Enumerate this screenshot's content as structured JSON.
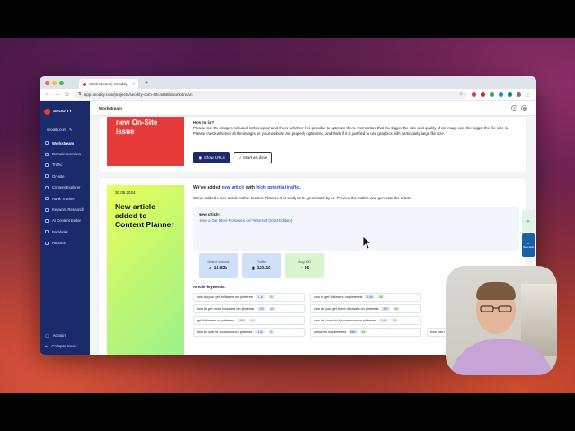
{
  "browser": {
    "tab_title": "Workstream | Seodity",
    "tab_close": "×",
    "new_tab": "+",
    "url": "app.seodity.com/projects/seodity-com-40c4a58b/workstream"
  },
  "sidebar": {
    "brand": "SEODITY",
    "domain": "seodity.com",
    "items": [
      {
        "label": "Workstream"
      },
      {
        "label": "Domain overview"
      },
      {
        "label": "Traffic"
      },
      {
        "label": "On-site"
      },
      {
        "label": "Content Explorer"
      },
      {
        "label": "Rank Tracker"
      },
      {
        "label": "Keyword Research"
      },
      {
        "label": "AI Content Editor"
      },
      {
        "label": "Backlinks"
      },
      {
        "label": "Reports"
      }
    ],
    "account": "Account",
    "collapse": "Collapse menu"
  },
  "topbar": {
    "title": "Workstream",
    "help": "?",
    "settings": "⚙"
  },
  "card1": {
    "hero_title": "new On-Site issue",
    "heading": "How to fix?",
    "text": "Please see the images included in this report and check whether it is possible to optimize them. Remember that the bigger the size and quality of an image are, the bigger the file size is. Please check whether all the images on your website are properly optimized, and think if it is justified to use graphics with particularly large file size.",
    "primary_btn": "Show URLs",
    "secondary_btn": "Mark as done"
  },
  "card2": {
    "date": "30.05.2024",
    "hero_title": "New article added to Content Planner",
    "headline_pre": "We've added ",
    "headline_link1": "new article",
    "headline_mid": " with ",
    "headline_link2": "high potential traffic",
    "headline_end": ".",
    "description": "We've added a new article to the Content Planner. It is ready to be generated by AI. Preview the outline and generate the article.",
    "new_article_label": "New article:",
    "new_article_link": "How to Get More Followers on Pinterest (2024 Edition)",
    "metrics": [
      {
        "label": "Search volume",
        "value": "14.82k"
      },
      {
        "label": "Traffic",
        "value": "129.19"
      },
      {
        "label": "Avg. KD",
        "value": "36"
      }
    ],
    "keywords_label": "Article keywords:",
    "keywords": [
      {
        "text": "how do you get followers on pinterest",
        "vol": "1.3k",
        "kd": "40"
      },
      {
        "text": "how to get followers on pinterest",
        "vol": "1.6k",
        "kd": "48"
      },
      {
        "text": "",
        "vol": "",
        "kd": ""
      },
      {
        "text": "how to get more followers on pinterest",
        "vol": "320",
        "kd": "40"
      },
      {
        "text": "how do you get more followers on pinterest",
        "vol": "320",
        "kd": "49"
      },
      {
        "text": "",
        "vol": "",
        "kd": ""
      },
      {
        "text": "get followers on pinterest",
        "vol": "140",
        "kd": "44"
      },
      {
        "text": "how do i search for someone on pinterest",
        "vol": "1.6k",
        "kd": "19"
      },
      {
        "text": "",
        "vol": "",
        "kd": ""
      },
      {
        "text": "how to look for someone on pinterest",
        "vol": "1.6k",
        "kd": "23"
      },
      {
        "text": "followers on pinterest",
        "vol": "880",
        "kd": "44"
      },
      {
        "text": "how can i follow someone",
        "vol": "",
        "kd": ""
      }
    ]
  },
  "side_widgets": {
    "new_task": "New task"
  }
}
